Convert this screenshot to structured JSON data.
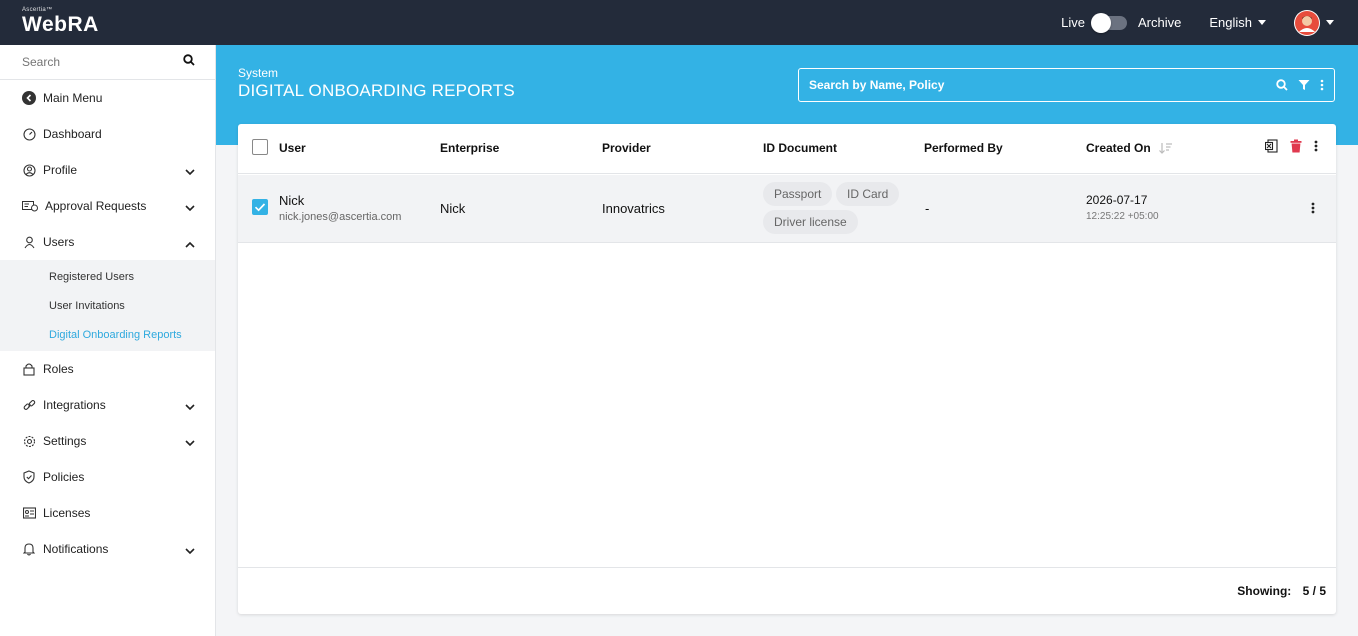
{
  "app": {
    "brand_small": "Ascertia™",
    "brand_main": "WebRA",
    "mode_live": "Live",
    "mode_archive": "Archive",
    "language": "English"
  },
  "sidebar": {
    "search_placeholder": "Search",
    "items": [
      {
        "label": "Main Menu",
        "icon": "back-arrow-icon"
      },
      {
        "label": "Dashboard",
        "icon": "dashboard-icon"
      },
      {
        "label": "Profile",
        "icon": "profile-icon",
        "expandable": true
      },
      {
        "label": "Approval Requests",
        "icon": "approval-icon",
        "expandable": true
      },
      {
        "label": "Users",
        "icon": "users-icon",
        "expanded": true
      },
      {
        "label": "Roles",
        "icon": "lock-icon"
      },
      {
        "label": "Integrations",
        "icon": "link-icon",
        "expandable": true
      },
      {
        "label": "Settings",
        "icon": "gear-icon",
        "expandable": true
      },
      {
        "label": "Policies",
        "icon": "shield-icon"
      },
      {
        "label": "Licenses",
        "icon": "license-icon"
      },
      {
        "label": "Notifications",
        "icon": "bell-icon",
        "expandable": true
      }
    ],
    "users_sub": [
      {
        "label": "Registered Users"
      },
      {
        "label": "User Invitations"
      },
      {
        "label": "Digital Onboarding Reports",
        "active": true
      }
    ]
  },
  "page": {
    "breadcrumb": "System",
    "title": "DIGITAL ONBOARDING REPORTS",
    "search_placeholder": "Search by Name, Policy"
  },
  "table": {
    "columns": {
      "user": "User",
      "enterprise": "Enterprise",
      "provider": "Provider",
      "id_document": "ID Document",
      "performed_by": "Performed By",
      "created_on": "Created On"
    },
    "rows": [
      {
        "checked": true,
        "user_name": "Nick",
        "user_email": "nick.jones@ascertia.com",
        "enterprise": "Nick",
        "provider": "Innovatrics",
        "documents": [
          "Passport",
          "ID Card",
          "Driver license"
        ],
        "performed_by": "-",
        "created_date": "2026-07-17",
        "created_time": "12:25:22 +05:00"
      }
    ],
    "showing_label": "Showing:",
    "showing_value": "5 / 5"
  },
  "colors": {
    "topbar": "#232b3a",
    "accent": "#33b2e5",
    "delete": "#e0394f"
  }
}
